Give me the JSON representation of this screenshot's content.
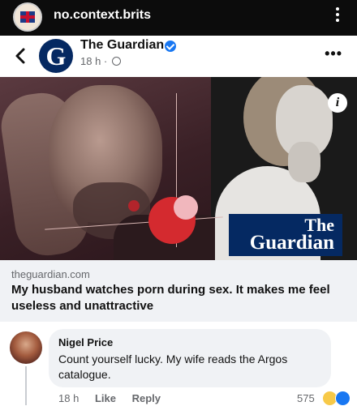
{
  "instagram": {
    "account_name": "no.context.brits",
    "avatar_icon": "union-jack-avatar-icon",
    "more_icon": "vertical-dots-icon"
  },
  "post": {
    "page_name": "The Guardian",
    "verified_icon": "verified-badge-icon",
    "time_ago": "18 h",
    "privacy_icon": "globe-icon",
    "more_icon": "horizontal-dots-icon"
  },
  "article": {
    "badge_line1": "The",
    "badge_line2": "Guardian",
    "domain": "theguardian.com",
    "title": "My husband watches porn during sex. It makes me feel useless and unattractive"
  },
  "comment": {
    "author": "Nigel Price",
    "text": "Count yourself lucky. My wife reads the Argos catalogue.",
    "time": "18 h",
    "like_label": "Like",
    "reply_label": "Reply",
    "reaction_count": "575"
  },
  "colors": {
    "guardian_blue": "#052962",
    "facebook_blue": "#1877f2",
    "accent_red": "#d42a2f"
  }
}
